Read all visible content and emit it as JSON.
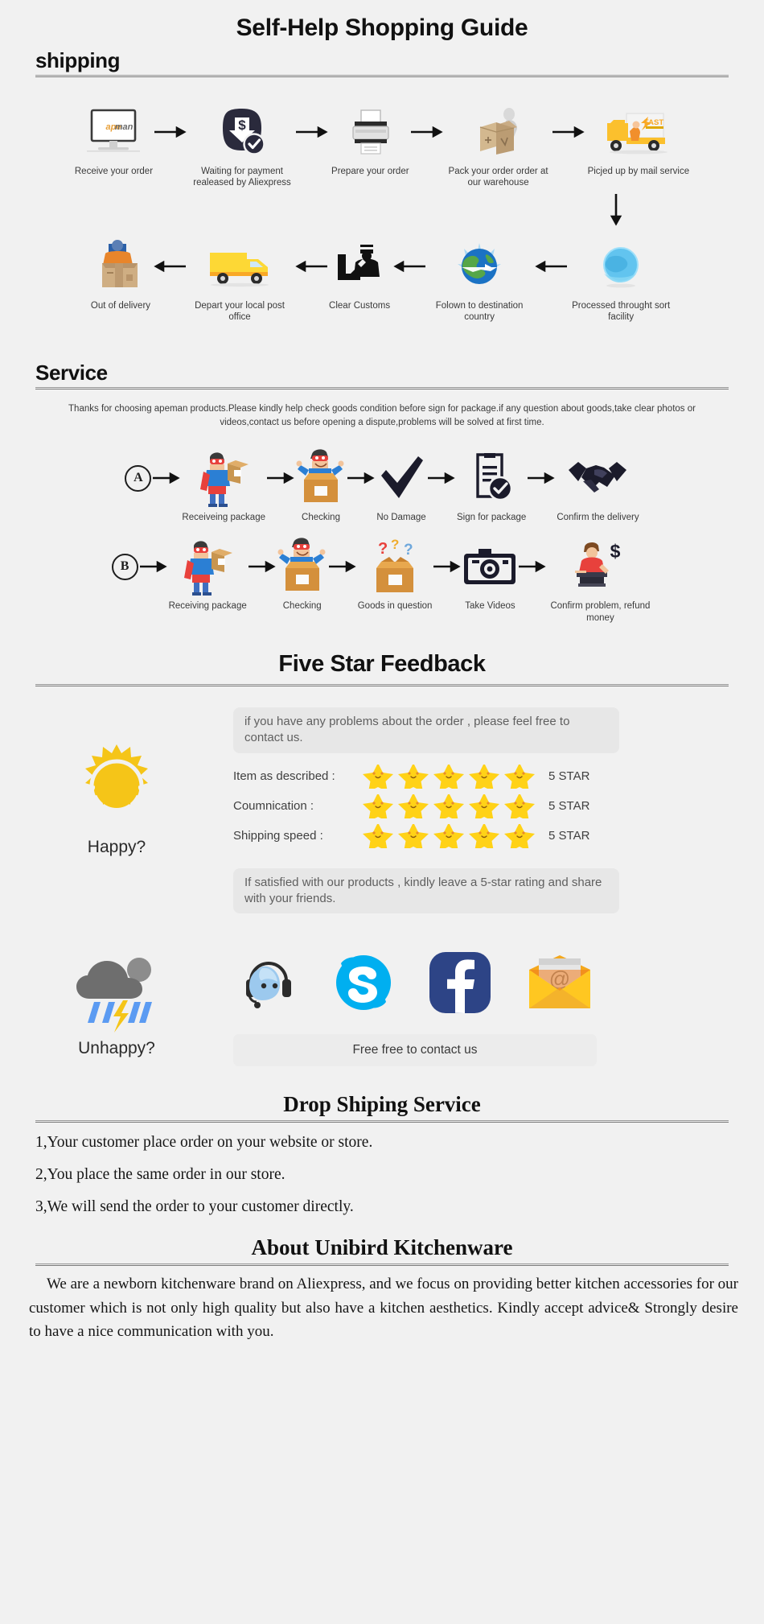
{
  "title": "Self-Help Shopping Guide",
  "shipping": {
    "heading": "shipping",
    "row1": [
      {
        "label": "Receive your order",
        "icon": "monitor-apeman-icon",
        "brand": "apeman"
      },
      {
        "label": "Waiting for payment realeased by Aliexpress",
        "icon": "payment-dollar-check-icon"
      },
      {
        "label": "Prepare your order",
        "icon": "printer-icon"
      },
      {
        "label": "Pack your order order at our warehouse",
        "icon": "worker-packing-box-icon"
      },
      {
        "label": "Picjed up by mail service",
        "icon": "fast-delivery-truck-icon",
        "truck_text": "FAST"
      }
    ],
    "row2": [
      {
        "label": "Out of delivery",
        "icon": "courier-with-box-icon"
      },
      {
        "label": "Depart your local post office",
        "icon": "yellow-van-icon"
      },
      {
        "label": "Clear Customs",
        "icon": "customs-officer-icon"
      },
      {
        "label": "Folown to destination country",
        "icon": "globe-airplane-icon"
      },
      {
        "label": "Processed throught sort facility",
        "icon": "blue-globe-icon"
      }
    ]
  },
  "service": {
    "heading": "Service",
    "note": "Thanks for choosing apeman products.Please kindly help check goods condition before sign for package.if any question about goods,take clear photos or videos,contact us before opening a dispute,problems will be solved at first time.",
    "rowA": {
      "badge": "A",
      "steps": [
        {
          "label": "Receiveing package",
          "icon": "hero-holding-package-icon"
        },
        {
          "label": "Checking",
          "icon": "hero-opening-box-icon"
        },
        {
          "label": "No Damage",
          "icon": "checkmark-icon"
        },
        {
          "label": "Sign for package",
          "icon": "clipboard-check-icon"
        },
        {
          "label": "Confirm the delivery",
          "icon": "handshake-icon"
        }
      ]
    },
    "rowB": {
      "badge": "B",
      "steps": [
        {
          "label": "Receiving package",
          "icon": "hero-holding-package-icon"
        },
        {
          "label": "Checking",
          "icon": "hero-opening-box-icon"
        },
        {
          "label": "Goods in question",
          "icon": "box-question-marks-icon"
        },
        {
          "label": "Take Videos",
          "icon": "camera-icon"
        },
        {
          "label": "Confirm problem, refund money",
          "icon": "person-refund-dollar-icon"
        }
      ]
    }
  },
  "feedback": {
    "heading": "Five Star Feedback",
    "bubble_top": "if you have any problems about the order , please feel free to contact us.",
    "bubble_bottom": "If satisfied with our products , kindly leave a 5-star rating and share with your friends.",
    "happy_label": "Happy?",
    "unhappy_label": "Unhappy?",
    "ratings": [
      {
        "label": "Item as described :",
        "stars": 5,
        "value": "5 STAR"
      },
      {
        "label": "Coumnication :",
        "stars": 5,
        "value": "5 STAR"
      },
      {
        "label": "Shipping speed :",
        "stars": 5,
        "value": "5 STAR"
      }
    ],
    "socials": [
      {
        "name": "trade-manager-icon"
      },
      {
        "name": "skype-icon"
      },
      {
        "name": "facebook-icon"
      },
      {
        "name": "email-icon"
      }
    ],
    "contact_button": "Free free to contact us"
  },
  "dropshipping": {
    "heading": "Drop Shiping Service",
    "lines": [
      "1,Your customer place order on your website or store.",
      "2,You place the same order in our store.",
      "3,We will send the order to your customer directly."
    ]
  },
  "about": {
    "heading": "About Unibird Kitchenware",
    "body": "We are a newborn kitchenware brand on Aliexpress, and we focus on providing better kitchen accessories for our customer which is not only high quality but also have a kitchen aesthetics. Kindly accept advice& Strongly desire to have a nice communication with you."
  },
  "colors": {
    "background": "#f1f1f1",
    "star_yellow": "#FFD217",
    "sun_yellow": "#F5C518",
    "skype_blue": "#00AFF0",
    "facebook_blue": "#2D4486",
    "envelope_yellow": "#FFC721",
    "dark_navy": "#2A2A3C"
  }
}
